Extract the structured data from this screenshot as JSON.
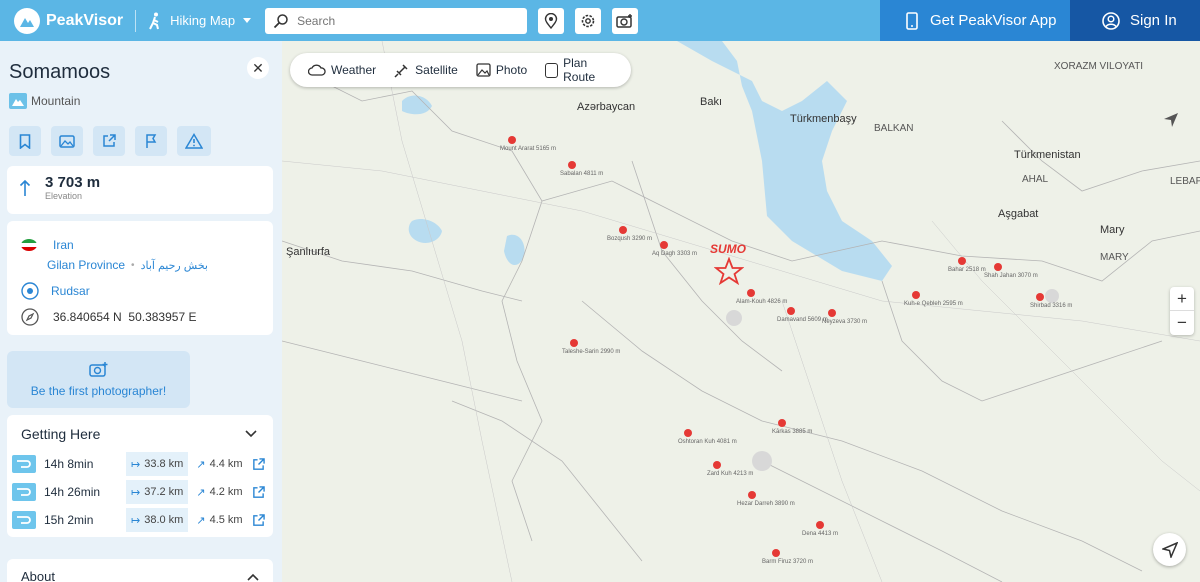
{
  "header": {
    "brand": "PeakVisor",
    "map_mode": "Hiking Map",
    "search_placeholder": "Search",
    "get_app": "Get PeakVisor App",
    "sign_in": "Sign In"
  },
  "peak": {
    "name": "Somamoos",
    "type": "Mountain",
    "elevation": "3 703 m",
    "elevation_label": "Elevation",
    "country": "Iran",
    "province": "Gilan Province",
    "district": "بخش رحیم آباد",
    "county": "Rudsar",
    "coordinates": "36.840654 N  50.383957 E"
  },
  "photo_prompt": "Be the first photographer!",
  "getting_here": {
    "title": "Getting Here",
    "routes": [
      {
        "time": "14h 8min",
        "distance": "33.8 km",
        "ascent": "4.4 km"
      },
      {
        "time": "14h 26min",
        "distance": "37.2 km",
        "ascent": "4.2 km"
      },
      {
        "time": "15h 2min",
        "distance": "38.0 km",
        "ascent": "4.5 km"
      }
    ]
  },
  "about_title": "About",
  "map_layers": [
    "Weather",
    "Satellite",
    "Photo",
    "Plan Route"
  ],
  "zoom": {
    "in": "+",
    "out": "−"
  },
  "map_labels": {
    "countries": [
      "Azərbaycan",
      "Türkmenbaşy",
      "Türkmenistan",
      "BALKAN",
      "AHAL",
      "Aşgabat",
      "Mary",
      "MARY",
      "Şanlıurfa",
      "Bakı",
      "XORAZM VILOYATI",
      "LEBAP"
    ],
    "marker": "SUMO",
    "peaks": [
      "Alam-Kouh 4826 m",
      "Damavand 5609 m",
      "Neyzeva 3730 m",
      "Taleshe-Sarin 2990 m",
      "Dena 4413 m",
      "Zard Kuh 4213 m",
      "Kārkas 3885 m",
      "Oshtoran Kuh 4081 m",
      "Shah Jahan 3070 m",
      "Shirbad 3316 m",
      "Mount Ararat 5165 m",
      "Sabalan 4811 m",
      "Aq Dagh 3303 m",
      "Bozqush 3290 m",
      "Kuh-e Qebleh 2595 m",
      "Bahar 2518 m",
      "Hezar Darreh 3890 m",
      "Barm Firuz 3720 m"
    ]
  },
  "colors": {
    "topbar": "#5bb6e5",
    "app_button": "#2a86d4",
    "signin_button": "#1657a4",
    "accent": "#2a86d4",
    "marker": "#e53935"
  }
}
